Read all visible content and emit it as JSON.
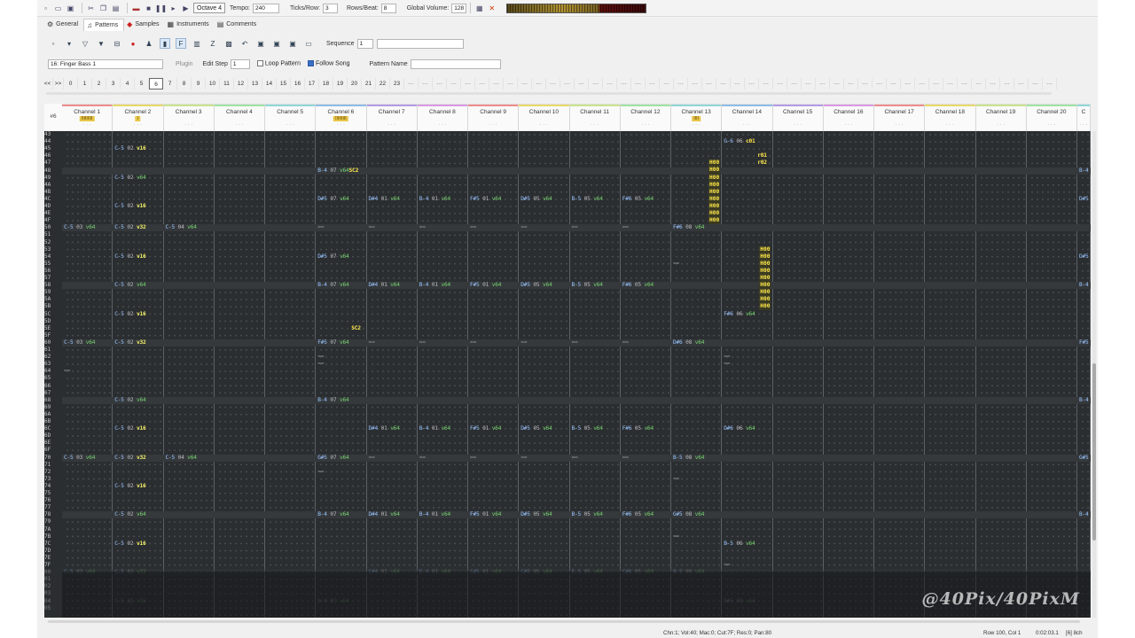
{
  "toolbar": {
    "octave": "Octave 4",
    "tempo_label": "Tempo:",
    "tempo": "240",
    "ticks_label": "Ticks/Row:",
    "ticks": "3",
    "rows_label": "Rows/Beat:",
    "rows": "8",
    "volume_label": "Global Volume:",
    "volume": "128",
    "vu_level": 0.66
  },
  "tabs": [
    {
      "label": "General",
      "icon": "gear-icon"
    },
    {
      "label": "Patterns",
      "icon": "note-icon"
    },
    {
      "label": "Samples",
      "icon": "sample-icon"
    },
    {
      "label": "Instruments",
      "icon": "instrument-icon"
    },
    {
      "label": "Comments",
      "icon": "comment-icon"
    }
  ],
  "active_tab": 1,
  "pattern": {
    "sequence_label": "Sequence",
    "sequence": "1",
    "instrument": "16: Finger Bass 1",
    "plugin_label": "Plugin",
    "edit_step_label": "Edit Step",
    "edit_step": "1",
    "loop_label": "Loop Pattern",
    "loop_checked": false,
    "follow_label": "Follow Song",
    "follow_checked": true,
    "name_label": "Pattern Name",
    "name": ""
  },
  "order": {
    "nav": "<<",
    "nav2": ">>",
    "items": [
      "0",
      "1",
      "2",
      "3",
      "4",
      "5",
      "6",
      "7",
      "8",
      "9",
      "10",
      "11",
      "12",
      "13",
      "14",
      "15",
      "16",
      "17",
      "18",
      "19",
      "20",
      "21",
      "22",
      "23"
    ],
    "current": 6,
    "empty_slots": 46
  },
  "grid": {
    "pattern_num": "#6",
    "channels": [
      {
        "name": "Channel 1",
        "color": "#ef8c8c",
        "tag": "IIIIIIIII"
      },
      {
        "name": "Channel 2",
        "color": "#e8d86a",
        "tag": "I"
      },
      {
        "name": "Channel 3",
        "color": "#c9e38a",
        "tag": ""
      },
      {
        "name": "Channel 4",
        "color": "#9fe2a3",
        "tag": ""
      },
      {
        "name": "Channel 5",
        "color": "#8fd7d7",
        "tag": ""
      },
      {
        "name": "Channel 6",
        "color": "#8fbbe8",
        "tag": "IIIIIIIII"
      },
      {
        "name": "Channel 7",
        "color": "#b49ae6",
        "tag": ""
      },
      {
        "name": "Channel 8",
        "color": "#d79ae0",
        "tag": ""
      },
      {
        "name": "Channel 9",
        "color": "#ef8c8c",
        "tag": ""
      },
      {
        "name": "Channel 10",
        "color": "#e8d86a",
        "tag": ""
      },
      {
        "name": "Channel 11",
        "color": "#c9e38a",
        "tag": ""
      },
      {
        "name": "Channel 12",
        "color": "#9fe2a3",
        "tag": ""
      },
      {
        "name": "Channel 13",
        "color": "#8fd7d7",
        "tag": "IIII"
      },
      {
        "name": "Channel 14",
        "color": "#8fbbe8",
        "tag": ""
      },
      {
        "name": "Channel 15",
        "color": "#b49ae6",
        "tag": ""
      },
      {
        "name": "Channel 16",
        "color": "#d79ae0",
        "tag": ""
      },
      {
        "name": "Channel 17",
        "color": "#ef8c8c",
        "tag": ""
      },
      {
        "name": "Channel 18",
        "color": "#e8d86a",
        "tag": ""
      },
      {
        "name": "Channel 19",
        "color": "#c9e38a",
        "tag": ""
      },
      {
        "name": "Channel 20",
        "color": "#9fe2a3",
        "tag": ""
      },
      {
        "name": "C",
        "color": "#8fd7d7",
        "tag": ""
      }
    ],
    "rows": [
      "43",
      "44",
      "45",
      "46",
      "47",
      "48",
      "49",
      "4A",
      "4B",
      "4C",
      "4D",
      "4E",
      "4F",
      "50",
      "51",
      "52",
      "53",
      "54",
      "55",
      "56",
      "57",
      "58",
      "59",
      "5A",
      "5B",
      "5C",
      "5D",
      "5E",
      "5F",
      "60",
      "61",
      "62",
      "63",
      "64",
      "65",
      "66",
      "67",
      "68",
      "69",
      "6A",
      "6B",
      "6C",
      "6D",
      "6E",
      "6F",
      "70",
      "71",
      "72",
      "73",
      "74",
      "75",
      "76",
      "77",
      "78",
      "79",
      "7A",
      "7B",
      "7C",
      "7D",
      "7E",
      "7F",
      "00",
      "01",
      "02",
      "03",
      "04",
      "05"
    ],
    "events": [
      {
        "r": 2,
        "c": 1,
        "n": "C-5",
        "i": "02",
        "v": "v16",
        "y": true
      },
      {
        "r": 6,
        "c": 1,
        "n": "C-5",
        "i": "02",
        "v": "v64"
      },
      {
        "r": 10,
        "c": 1,
        "n": "C-5",
        "i": "02",
        "v": "v16",
        "y": true
      },
      {
        "r": 13,
        "c": 0,
        "n": "C-5",
        "i": "03",
        "v": "v64"
      },
      {
        "r": 13,
        "c": 1,
        "n": "C-5",
        "i": "02",
        "v": "v32",
        "y": true
      },
      {
        "r": 13,
        "c": 2,
        "n": "C-5",
        "i": "04",
        "v": "v64"
      },
      {
        "r": 17,
        "c": 1,
        "n": "C-5",
        "i": "02",
        "v": "v16",
        "y": true
      },
      {
        "r": 21,
        "c": 1,
        "n": "C-5",
        "i": "02",
        "v": "v64"
      },
      {
        "r": 25,
        "c": 1,
        "n": "C-5",
        "i": "02",
        "v": "v16",
        "y": true
      },
      {
        "r": 29,
        "c": 0,
        "n": "C-5",
        "i": "03",
        "v": "v64"
      },
      {
        "r": 29,
        "c": 1,
        "n": "C-5",
        "i": "02",
        "v": "v32",
        "y": true
      },
      {
        "r": 37,
        "c": 1,
        "n": "C-5",
        "i": "02",
        "v": "v64"
      },
      {
        "r": 41,
        "c": 1,
        "n": "C-5",
        "i": "02",
        "v": "v16",
        "y": true
      },
      {
        "r": 45,
        "c": 0,
        "n": "C-5",
        "i": "03",
        "v": "v64"
      },
      {
        "r": 45,
        "c": 1,
        "n": "C-5",
        "i": "02",
        "v": "v32",
        "y": true
      },
      {
        "r": 45,
        "c": 2,
        "n": "C-5",
        "i": "04",
        "v": "v64"
      },
      {
        "r": 49,
        "c": 1,
        "n": "C-5",
        "i": "02",
        "v": "v16",
        "y": true
      },
      {
        "r": 53,
        "c": 1,
        "n": "C-5",
        "i": "02",
        "v": "v64"
      },
      {
        "r": 57,
        "c": 1,
        "n": "C-5",
        "i": "02",
        "v": "v16",
        "y": true
      },
      {
        "r": 61,
        "c": 0,
        "n": "C-5",
        "i": "03",
        "v": "v64",
        "d": true
      },
      {
        "r": 61,
        "c": 1,
        "n": "C-5",
        "i": "02",
        "v": "v32",
        "d": true
      },
      {
        "r": 65,
        "c": 1,
        "n": "C-5",
        "i": "02",
        "v": "v16",
        "d": true
      },
      {
        "r": 5,
        "c": 5,
        "n": "B-4",
        "i": "07",
        "v": "v64",
        "fx": "SC2"
      },
      {
        "r": 9,
        "c": 5,
        "n": "D#5",
        "i": "07",
        "v": "v64"
      },
      {
        "r": 17,
        "c": 5,
        "n": "D#5",
        "i": "07",
        "v": "v64"
      },
      {
        "r": 21,
        "c": 5,
        "n": "B-4",
        "i": "07",
        "v": "v64"
      },
      {
        "r": 27,
        "c": 5,
        "n": "",
        "i": "",
        "v": "",
        "fx": "SC2"
      },
      {
        "r": 29,
        "c": 5,
        "n": "F#5",
        "i": "07",
        "v": "v64"
      },
      {
        "r": 37,
        "c": 5,
        "n": "B-4",
        "i": "07",
        "v": "v64"
      },
      {
        "r": 45,
        "c": 5,
        "n": "G#5",
        "i": "07",
        "v": "v64"
      },
      {
        "r": 53,
        "c": 5,
        "n": "B-4",
        "i": "07",
        "v": "v64"
      },
      {
        "r": 65,
        "c": 5,
        "n": "B-4",
        "i": "07",
        "v": "v64",
        "d": true
      },
      {
        "r": 9,
        "c": 6,
        "n": "D#4",
        "i": "01",
        "v": "v64"
      },
      {
        "r": 21,
        "c": 6,
        "n": "D#4",
        "i": "01",
        "v": "v64"
      },
      {
        "r": 41,
        "c": 6,
        "n": "D#4",
        "i": "01",
        "v": "v64"
      },
      {
        "r": 53,
        "c": 6,
        "n": "D#4",
        "i": "01",
        "v": "v64"
      },
      {
        "r": 61,
        "c": 6,
        "n": "C#4",
        "i": "01",
        "v": "v64",
        "d": true
      },
      {
        "r": 9,
        "c": 7,
        "n": "B-4",
        "i": "01",
        "v": "v64"
      },
      {
        "r": 21,
        "c": 7,
        "n": "B-4",
        "i": "01",
        "v": "v64"
      },
      {
        "r": 41,
        "c": 7,
        "n": "B-4",
        "i": "01",
        "v": "v64"
      },
      {
        "r": 53,
        "c": 7,
        "n": "B-4",
        "i": "01",
        "v": "v64"
      },
      {
        "r": 61,
        "c": 7,
        "n": "E-4",
        "i": "01",
        "v": "v64",
        "d": true
      },
      {
        "r": 9,
        "c": 8,
        "n": "F#5",
        "i": "01",
        "v": "v64"
      },
      {
        "r": 21,
        "c": 8,
        "n": "F#5",
        "i": "01",
        "v": "v64"
      },
      {
        "r": 41,
        "c": 8,
        "n": "F#5",
        "i": "01",
        "v": "v64"
      },
      {
        "r": 53,
        "c": 8,
        "n": "F#5",
        "i": "01",
        "v": "v64"
      },
      {
        "r": 61,
        "c": 8,
        "n": "C#5",
        "i": "01",
        "v": "v64",
        "d": true
      },
      {
        "r": 9,
        "c": 9,
        "n": "D#5",
        "i": "05",
        "v": "v64"
      },
      {
        "r": 21,
        "c": 9,
        "n": "D#5",
        "i": "05",
        "v": "v64"
      },
      {
        "r": 41,
        "c": 9,
        "n": "D#5",
        "i": "05",
        "v": "v64"
      },
      {
        "r": 53,
        "c": 9,
        "n": "D#5",
        "i": "05",
        "v": "v64"
      },
      {
        "r": 61,
        "c": 9,
        "n": "C#5",
        "i": "05",
        "v": "v64",
        "d": true
      },
      {
        "r": 9,
        "c": 10,
        "n": "B-5",
        "i": "05",
        "v": "v64"
      },
      {
        "r": 21,
        "c": 10,
        "n": "B-5",
        "i": "05",
        "v": "v64"
      },
      {
        "r": 41,
        "c": 10,
        "n": "B-5",
        "i": "05",
        "v": "v64"
      },
      {
        "r": 53,
        "c": 10,
        "n": "B-5",
        "i": "05",
        "v": "v64"
      },
      {
        "r": 61,
        "c": 10,
        "n": "E-5",
        "i": "05",
        "v": "v64",
        "d": true
      },
      {
        "r": 9,
        "c": 11,
        "n": "F#6",
        "i": "05",
        "v": "v64"
      },
      {
        "r": 21,
        "c": 11,
        "n": "F#6",
        "i": "05",
        "v": "v64"
      },
      {
        "r": 41,
        "c": 11,
        "n": "F#6",
        "i": "05",
        "v": "v64"
      },
      {
        "r": 53,
        "c": 11,
        "n": "F#6",
        "i": "05",
        "v": "v64"
      },
      {
        "r": 61,
        "c": 11,
        "n": "C#6",
        "i": "05",
        "v": "v64",
        "d": true
      },
      {
        "r": 13,
        "c": 12,
        "n": "F#6",
        "i": "08",
        "v": "v64"
      },
      {
        "r": 29,
        "c": 12,
        "n": "D#6",
        "i": "08",
        "v": "v64"
      },
      {
        "r": 45,
        "c": 12,
        "n": "B-5",
        "i": "08",
        "v": "v64"
      },
      {
        "r": 53,
        "c": 12,
        "n": "G#5",
        "i": "08",
        "v": "v64"
      },
      {
        "r": 61,
        "c": 12,
        "n": "B-5",
        "i": "08",
        "v": "v64",
        "d": true
      },
      {
        "r": 1,
        "c": 13,
        "n": "G-6",
        "i": "06",
        "v": "",
        "fx": "c01"
      },
      {
        "r": 3,
        "c": 13,
        "n": "",
        "i": "",
        "v": "",
        "fx": "r01"
      },
      {
        "r": 4,
        "c": 13,
        "n": "",
        "i": "",
        "v": "",
        "fx": "r02"
      },
      {
        "r": 25,
        "c": 13,
        "n": "F#6",
        "i": "06",
        "v": "v64"
      },
      {
        "r": 41,
        "c": 13,
        "n": "D#6",
        "i": "06",
        "v": "v64"
      },
      {
        "r": 57,
        "c": 13,
        "n": "B-5",
        "i": "06",
        "v": "v64"
      },
      {
        "r": 65,
        "c": 13,
        "n": "D#5",
        "i": "08",
        "v": "v64",
        "d": true
      },
      {
        "r": 5,
        "c": 20,
        "n": "B-4",
        "i": "",
        "v": ""
      },
      {
        "r": 9,
        "c": 20,
        "n": "D#5",
        "i": "",
        "v": ""
      },
      {
        "r": 17,
        "c": 20,
        "n": "D#5",
        "i": "",
        "v": ""
      },
      {
        "r": 21,
        "c": 20,
        "n": "B-4",
        "i": "",
        "v": ""
      },
      {
        "r": 29,
        "c": 20,
        "n": "F#5",
        "i": "",
        "v": ""
      },
      {
        "r": 37,
        "c": 20,
        "n": "B-4",
        "i": "",
        "v": ""
      },
      {
        "r": 45,
        "c": 20,
        "n": "G#5",
        "i": "",
        "v": ""
      },
      {
        "r": 53,
        "c": 20,
        "n": "B-4",
        "i": "",
        "v": ""
      }
    ],
    "hstacks": [
      {
        "c": 12,
        "r0": 4,
        "text": [
          "H00",
          "H00",
          "H00",
          "H00",
          "H00",
          "H00",
          "H00",
          "H00",
          "H00"
        ]
      },
      {
        "c": 13,
        "r0": 16,
        "text": [
          "H00",
          "H00",
          "H00",
          "H00",
          "H00",
          "H00",
          "H00",
          "H00",
          "H00"
        ]
      }
    ],
    "offmarks": [
      {
        "r": 13,
        "c": 5
      },
      {
        "r": 13,
        "c": 6
      },
      {
        "r": 13,
        "c": 7
      },
      {
        "r": 13,
        "c": 8
      },
      {
        "r": 13,
        "c": 9
      },
      {
        "r": 13,
        "c": 10
      },
      {
        "r": 13,
        "c": 11
      },
      {
        "r": 29,
        "c": 6
      },
      {
        "r": 29,
        "c": 7
      },
      {
        "r": 29,
        "c": 8
      },
      {
        "r": 29,
        "c": 9
      },
      {
        "r": 29,
        "c": 10
      },
      {
        "r": 29,
        "c": 11
      },
      {
        "r": 45,
        "c": 6
      },
      {
        "r": 45,
        "c": 7
      },
      {
        "r": 45,
        "c": 8
      },
      {
        "r": 45,
        "c": 9
      },
      {
        "r": 45,
        "c": 10
      },
      {
        "r": 45,
        "c": 11
      },
      {
        "r": 31,
        "c": 5
      },
      {
        "r": 32,
        "c": 5
      },
      {
        "r": 47,
        "c": 5
      },
      {
        "r": 18,
        "c": 12
      },
      {
        "r": 31,
        "c": 13
      },
      {
        "r": 32,
        "c": 13
      },
      {
        "r": 48,
        "c": 12
      },
      {
        "r": 56,
        "c": 12
      },
      {
        "r": 60,
        "c": 13
      },
      {
        "r": 33,
        "c": 0
      }
    ]
  },
  "watermark": "@40Pix/40PixM",
  "status": {
    "cell": "Chn:1; Vol:40; Mac:0; Cut:7F; Res:0; Pan:80",
    "pos": "Row 100, Col 1",
    "time": "0:02:03.1",
    "chn": "[6] 8ch"
  }
}
